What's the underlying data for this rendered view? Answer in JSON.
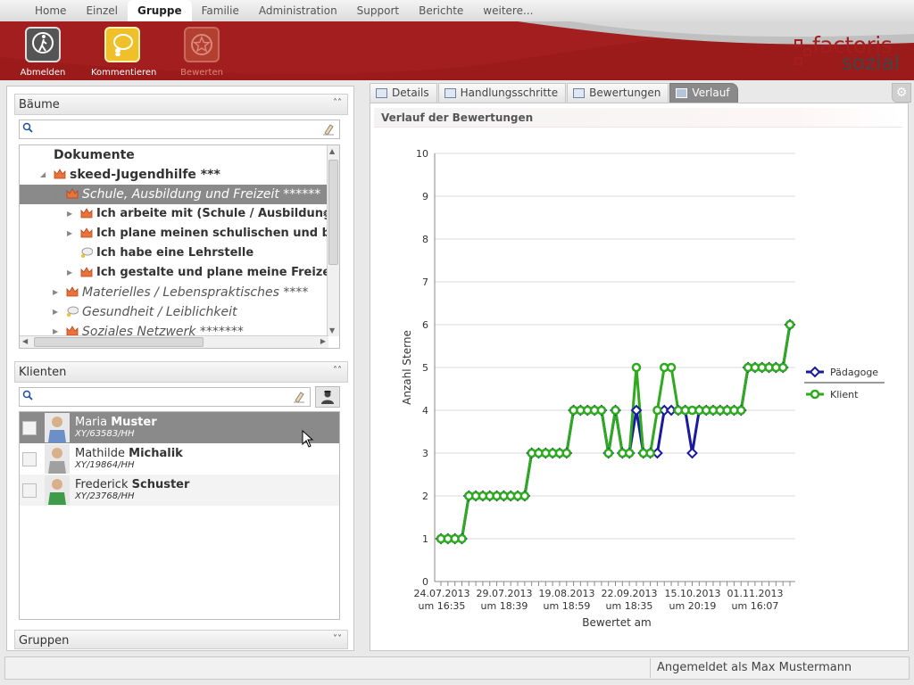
{
  "nav": {
    "items": [
      "Home",
      "Einzel",
      "Gruppe",
      "Familie",
      "Administration",
      "Support",
      "Berichte",
      "weitere..."
    ],
    "active_index": 2
  },
  "toolbar": {
    "logout_label": "Abmelden",
    "comment_label": "Kommentieren",
    "rate_label": "Bewerten"
  },
  "logo": {
    "line1": "factoris",
    "line2": "sozial"
  },
  "colors": {
    "brand_red": "#a31e1e",
    "paedagoge_series": "#1a1aa0",
    "klient_series": "#2eaa1e"
  },
  "trees_panel": {
    "title": "Bäume",
    "search_placeholder": "",
    "items": [
      {
        "label": "Dokumente",
        "level": 0,
        "style": "bold"
      },
      {
        "label": "skeed-Jugendhilfe ***",
        "level": 0,
        "style": "bold"
      },
      {
        "label": "Schule, Ausbildung und Freizeit ******",
        "level": 1,
        "style": "italic",
        "selected": true
      },
      {
        "label": "Ich arbeite mit (Schule / Ausbildung) ***",
        "level": 2,
        "style": "bold"
      },
      {
        "label": "Ich plane meinen schulischen und beruflic",
        "level": 2,
        "style": "bold"
      },
      {
        "label": "Ich habe eine Lehrstelle",
        "level": 2,
        "style": "bold",
        "icon": "speech-bubble-icon"
      },
      {
        "label": "Ich gestalte und plane meine Freizeit ***",
        "level": 2,
        "style": "bold"
      },
      {
        "label": "Materielles / Lebenspraktisches ****",
        "level": 1,
        "style": "italic"
      },
      {
        "label": "Gesundheit / Leiblichkeit",
        "level": 1,
        "style": "italic",
        "icon": "speech-bubble-icon"
      },
      {
        "label": "Soziales Netzwerk *******",
        "level": 1,
        "style": "italic"
      }
    ]
  },
  "clients_panel": {
    "title": "Klienten",
    "search_placeholder": "",
    "clients": [
      {
        "first": "Maria",
        "last": "Muster",
        "id": "XY/63583/HH",
        "selected": true
      },
      {
        "first": "Mathilde",
        "last": "Michalik",
        "id": "XY/19864/HH",
        "selected": false
      },
      {
        "first": "Frederick",
        "last": "Schuster",
        "id": "XY/23768/HH",
        "selected": false
      }
    ]
  },
  "groups_panel": {
    "title": "Gruppen"
  },
  "tabs": [
    {
      "label": "Details",
      "active": false
    },
    {
      "label": "Handlungsschritte",
      "active": false
    },
    {
      "label": "Bewertungen",
      "active": false
    },
    {
      "label": "Verlauf",
      "active": true
    }
  ],
  "content": {
    "title": "Verlauf der Bewertungen"
  },
  "chart_data": {
    "type": "line",
    "title": "",
    "xlabel": "Bewertet am",
    "ylabel": "Anzahl Sterne",
    "ylim": [
      0,
      10
    ],
    "yticks": [
      0,
      1,
      2,
      3,
      4,
      5,
      6,
      7,
      8,
      9,
      10
    ],
    "xtick_labels": [
      {
        "date": "24.07.2013",
        "time": "um 16:35"
      },
      {
        "date": "29.07.2013",
        "time": "um 18:39"
      },
      {
        "date": "19.08.2013",
        "time": "um 18:59"
      },
      {
        "date": "22.09.2013",
        "time": "um 18:35"
      },
      {
        "date": "15.10.2013",
        "time": "um 20:19"
      },
      {
        "date": "01.11.2013",
        "time": "um 16:07"
      }
    ],
    "grid": true,
    "legend_position": "right",
    "series": [
      {
        "name": "Pädagoge",
        "values": [
          1,
          1,
          1,
          1,
          2,
          2,
          2,
          2,
          2,
          2,
          2,
          2,
          2,
          3,
          3,
          3,
          3,
          3,
          3,
          4,
          4,
          4,
          4,
          4,
          3,
          4,
          3,
          3,
          4,
          3,
          3,
          3,
          4,
          4,
          4,
          4,
          3,
          4,
          4,
          4,
          4,
          4,
          4,
          4,
          5,
          5,
          5,
          5,
          5,
          5,
          6
        ]
      },
      {
        "name": "Klient",
        "values": [
          1,
          1,
          1,
          1,
          2,
          2,
          2,
          2,
          2,
          2,
          2,
          2,
          2,
          3,
          3,
          3,
          3,
          3,
          3,
          4,
          4,
          4,
          4,
          4,
          3,
          4,
          3,
          3,
          5,
          3,
          3,
          4,
          5,
          5,
          4,
          4,
          4,
          4,
          4,
          4,
          4,
          4,
          4,
          4,
          5,
          5,
          5,
          5,
          5,
          5,
          6
        ]
      }
    ]
  },
  "status": {
    "text": "Angemeldet als Max Mustermann"
  }
}
